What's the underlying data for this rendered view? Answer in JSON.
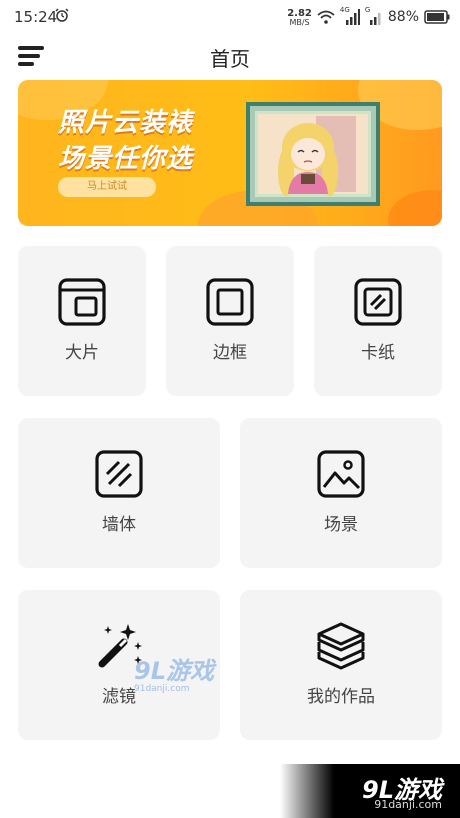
{
  "status_bar": {
    "time": "15:24",
    "speed_value": "2.82",
    "speed_unit": "MB/S",
    "network_label": "4G",
    "network_label2": "G",
    "battery_percent": "88%"
  },
  "header": {
    "title": "首页",
    "menu_icon": "menu-icon"
  },
  "banner": {
    "headline_line1": "照片云装裱",
    "headline_line2": "场景任你选",
    "cta_label": "马上试试",
    "colors": {
      "bg_start": "#ffb51e",
      "bg_end": "#ff9a1f"
    }
  },
  "features": [
    {
      "label": "大片",
      "icon": "photo-frame-icon"
    },
    {
      "label": "边框",
      "icon": "border-frame-icon"
    },
    {
      "label": "卡纸",
      "icon": "card-paper-icon"
    },
    {
      "label": "墙体",
      "icon": "wall-icon"
    },
    {
      "label": "场景",
      "icon": "scene-image-icon"
    },
    {
      "label": "滤镜",
      "icon": "magic-wand-icon"
    },
    {
      "label": "我的作品",
      "icon": "layers-icon"
    }
  ],
  "watermark": {
    "logo": "9L游戏",
    "url": "91danji.com"
  }
}
